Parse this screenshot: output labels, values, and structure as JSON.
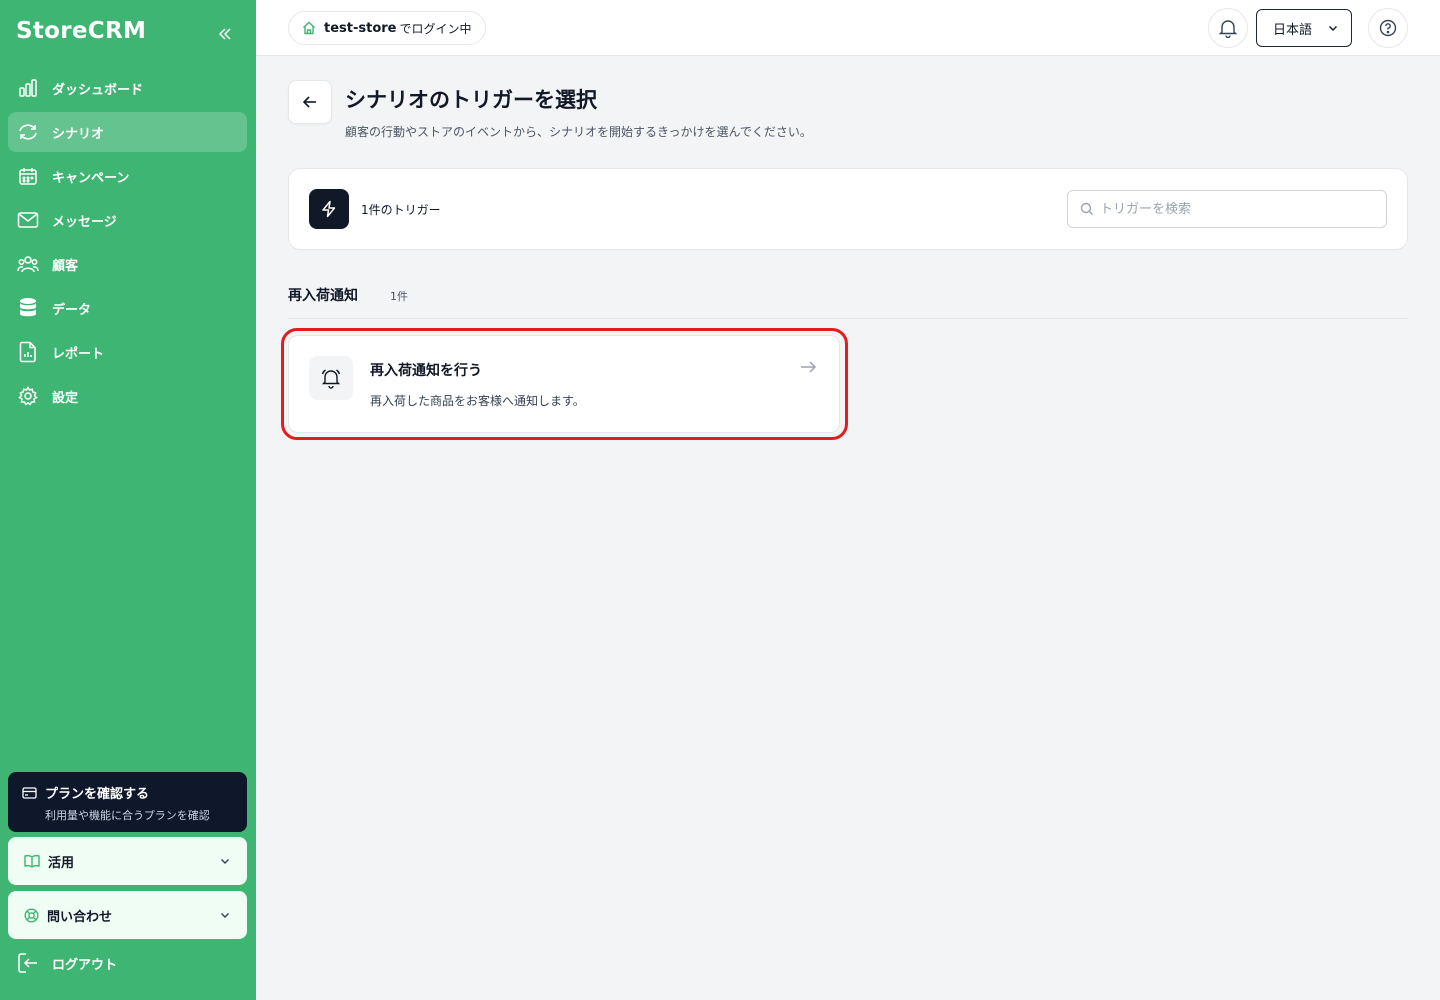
{
  "sidebar": {
    "brand": "StoreCRM",
    "nav": [
      {
        "label": "ダッシュボード",
        "icon": "bar-chart-icon",
        "active": false
      },
      {
        "label": "シナリオ",
        "icon": "refresh-icon",
        "active": true
      },
      {
        "label": "キャンペーン",
        "icon": "calendar-icon",
        "active": false
      },
      {
        "label": "メッセージ",
        "icon": "mail-icon",
        "active": false
      },
      {
        "label": "顧客",
        "icon": "users-icon",
        "active": false
      },
      {
        "label": "データ",
        "icon": "database-icon",
        "active": false
      },
      {
        "label": "レポート",
        "icon": "report-file-icon",
        "active": false
      },
      {
        "label": "設定",
        "icon": "gear-icon",
        "active": false
      }
    ],
    "plan": {
      "title": "プランを確認する",
      "subtitle": "利用量や機能に合うプランを確認"
    },
    "usage": {
      "label": "活用"
    },
    "contact": {
      "label": "問い合わせ"
    },
    "logout": {
      "label": "ログアウト"
    }
  },
  "header": {
    "store_name": "test-store",
    "store_suffix": "でログイン中",
    "language": "日本語"
  },
  "page": {
    "title": "シナリオのトリガーを選択",
    "subtitle": "顧客の行動やストアのイベントから、シナリオを開始するきっかけを選んでください。"
  },
  "summary": {
    "count_label": "1件のトリガー",
    "search_placeholder": "トリガーを検索",
    "search_value": ""
  },
  "section": {
    "title": "再入荷通知",
    "count": "1件"
  },
  "triggers": [
    {
      "title": "再入荷通知を行う",
      "description": "再入荷した商品をお客様へ通知します。"
    }
  ],
  "colors": {
    "sidebar_bg": "#3fb573",
    "dark": "#111827",
    "highlight": "#e11d1d"
  }
}
